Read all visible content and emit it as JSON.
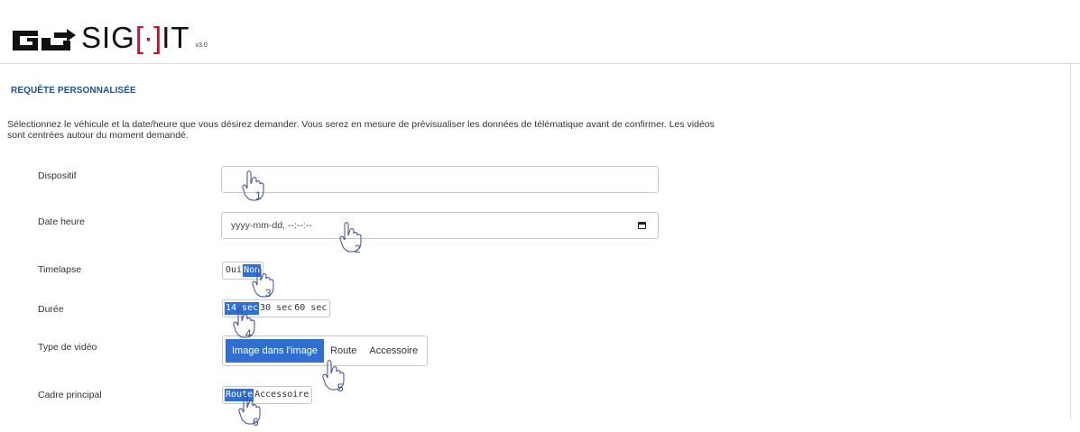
{
  "header": {
    "logo_text": "SIG",
    "logo_text_tail": "IT",
    "version": "v3.0"
  },
  "page": {
    "section_title": "REQUÊTE PERSONNALISÉE",
    "intro_text": "Sélectionnez le véhicule et la date/heure que vous désirez demander. Vous serez en mesure de prévisualiser les données de télématique avant de confirmer. Les vidéos sont centrées autour du moment demandé."
  },
  "form": {
    "device": {
      "label": "Dispositif",
      "value": ""
    },
    "datetime": {
      "label": "Date heure",
      "value": "yyyy-mm-dd, --:--:--"
    },
    "timelapse": {
      "label": "Timelapse",
      "options": [
        "Oui",
        "Non"
      ],
      "selected": "Non"
    },
    "duration": {
      "label": "Durée",
      "options": [
        "14 sec",
        "30 sec",
        "60 sec"
      ],
      "selected": "14 sec"
    },
    "video_type": {
      "label": "Type de vidéo",
      "options": [
        "Image dans l'image",
        "Route",
        "Accessoire"
      ],
      "selected": "Image dans l'image"
    },
    "main_frame": {
      "label": "Cadre principal",
      "options": [
        "Route",
        "Accessoire"
      ],
      "selected": "Route"
    }
  },
  "annotations": {
    "step1": "1",
    "step2": "2",
    "step3": "3",
    "step4": "4",
    "step5": "5",
    "step6": "6"
  },
  "colors": {
    "accent": "#2f6fd1",
    "title": "#1f4e9a",
    "logo_red": "#c8102e"
  }
}
